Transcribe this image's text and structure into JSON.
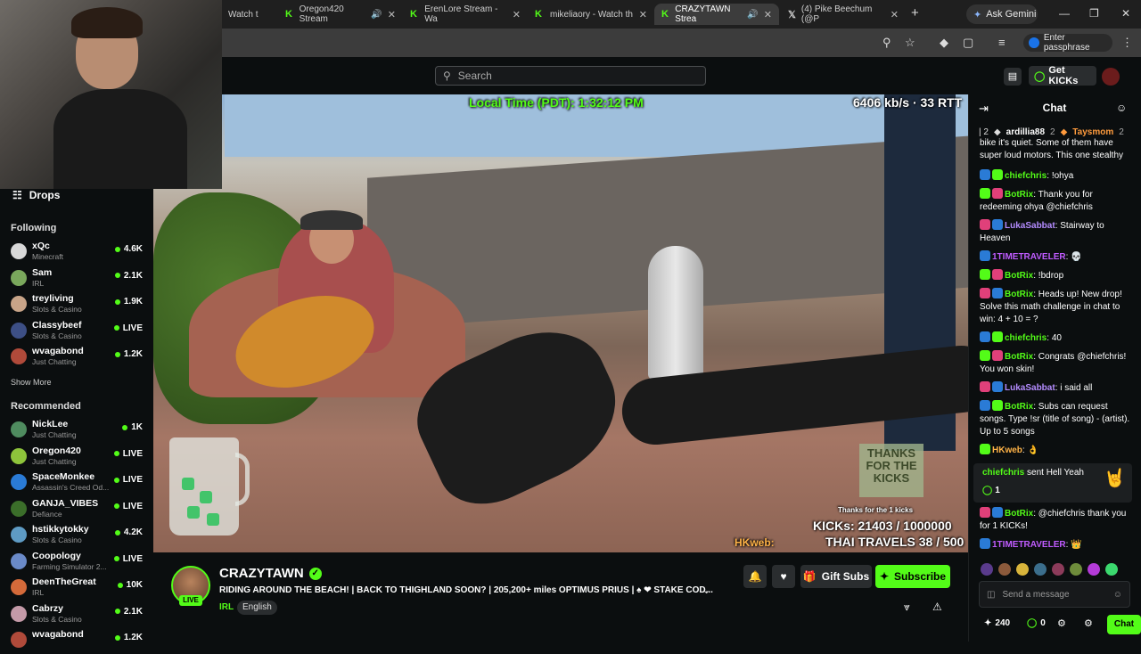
{
  "browser": {
    "tabs": [
      {
        "label": "Watch t",
        "partial": true
      },
      {
        "label": "Oregon420 Stream"
      },
      {
        "label": "ErenLore Stream - Wa"
      },
      {
        "label": "mikeliaory - Watch th"
      },
      {
        "label": "CRAZYTAWN Strea",
        "active": true
      },
      {
        "label": "(4) Pike Beechum (@P"
      }
    ],
    "ask_gemini": "Ask Gemini",
    "passphrase": "Enter passphrase"
  },
  "topnav": {
    "search_placeholder": "Search",
    "get_kicks": "Get KICKs"
  },
  "sidebar": {
    "drops": "Drops",
    "following_title": "Following",
    "following": [
      {
        "name": "xQc",
        "category": "Minecraft",
        "viewers": "4.6K",
        "color": "#d8d8d8"
      },
      {
        "name": "Sam",
        "category": "IRL",
        "viewers": "2.1K",
        "color": "#7aa85c"
      },
      {
        "name": "treyliving",
        "category": "Slots & Casino",
        "viewers": "1.9K",
        "color": "#c8a488"
      },
      {
        "name": "Classybeef",
        "category": "Slots & Casino",
        "viewers": "LIVE",
        "color": "#3d4f85"
      },
      {
        "name": "wvagabond",
        "category": "Just Chatting",
        "viewers": "1.2K",
        "color": "#b04a3a"
      }
    ],
    "show_more": "Show More",
    "recommended_title": "Recommended",
    "recommended": [
      {
        "name": "NickLee",
        "category": "Just Chatting",
        "viewers": "1K",
        "color": "#4f8c5f"
      },
      {
        "name": "Oregon420",
        "category": "Just Chatting",
        "viewers": "LIVE",
        "color": "#8ec43b"
      },
      {
        "name": "SpaceMonkee",
        "category": "Assassin's Creed Od...",
        "viewers": "LIVE",
        "color": "#2a7bd6"
      },
      {
        "name": "GANJA_VIBES",
        "category": "Defiance",
        "viewers": "LIVE",
        "color": "#3b6e2a"
      },
      {
        "name": "hstikkytokky",
        "category": "Slots & Casino",
        "viewers": "4.2K",
        "color": "#5e9bc4"
      },
      {
        "name": "Coopology",
        "category": "Farming Simulator 2...",
        "viewers": "LIVE",
        "color": "#6a8ac8"
      },
      {
        "name": "DeenTheGreat",
        "category": "IRL",
        "viewers": "10K",
        "color": "#d46a3a"
      },
      {
        "name": "Cabrzy",
        "category": "Slots & Casino",
        "viewers": "2.1K",
        "color": "#c49aa8"
      },
      {
        "name": "wvagabond",
        "category": "",
        "viewers": "1.2K",
        "color": "#b04a3a"
      }
    ]
  },
  "video": {
    "local_time": "Local Time (PDT): 1:32:12 PM",
    "stats": "6406 kb/s · 33 RTT",
    "kicks": "KICKs: 21403 / 1000000",
    "travels": "THAI TRAVELS 38 / 500",
    "hkweb": "HKweb:",
    "thanks_box": "THANKS FOR THE KICKS",
    "thanks_line": "Thanks for the 1 kicks"
  },
  "channel": {
    "name": "CRAZYTAWN",
    "live": "LIVE",
    "title": "RIDING AROUND THE BEACH! | BACK TO THIGHLAND SOON? | 205,200+ miles OPTIMUS PRIUS | ♠ ❤ STAKE COD...",
    "category": "IRL",
    "language": "English",
    "gift_subs": "Gift Subs",
    "subscribe": "Subscribe"
  },
  "chat": {
    "title": "Chat",
    "top_gifters": [
      {
        "name": "ardillia88",
        "count": "2"
      },
      {
        "name": "Taysmom",
        "count": "2"
      }
    ],
    "messages": [
      {
        "user": "",
        "text": "bike it's quiet. Some of them have super loud motors. This one stealthy",
        "color": "#fff"
      },
      {
        "user": "chiefchris",
        "text": "!ohya",
        "color": "#53fc18"
      },
      {
        "user": "BotRix",
        "text": "Thank you for redeeming ohya @chiefchris",
        "color": "#53fc18"
      },
      {
        "user": "LukaSabbat",
        "text": "Stairway to Heaven",
        "color": "#b48cff"
      },
      {
        "user": "1TIMETRAVELER",
        "text": "💀",
        "color": "#c05cff"
      },
      {
        "user": "BotRix",
        "text": "!bdrop",
        "color": "#53fc18"
      },
      {
        "user": "BotRix",
        "text": "Heads up! New drop! Solve this math challenge in chat to win: 4 + 10 = ?",
        "color": "#53fc18"
      },
      {
        "user": "chiefchris",
        "text": "40",
        "color": "#53fc18"
      },
      {
        "user": "BotRix",
        "text": "Congrats @chiefchris! You won skin!",
        "color": "#53fc18"
      },
      {
        "user": "LukaSabbat",
        "text": "i said all",
        "color": "#b48cff"
      },
      {
        "user": "BotRix",
        "text": "Subs can request songs. Type !sr (title of song) - (artist). Up to 5 songs",
        "color": "#53fc18"
      },
      {
        "user": "HKweb",
        "text": "👌",
        "color": "#ffb347"
      },
      {
        "user": "BotRix",
        "text": "@chiefchris thank you for 1 KICKs!",
        "color": "#53fc18"
      },
      {
        "user": "1TIMETRAVELER",
        "text": "👑",
        "color": "#c05cff"
      }
    ],
    "kick_gift": {
      "user": "chiefchris",
      "text": "sent Hell Yeah",
      "count": "1"
    },
    "input_placeholder": "Send a message",
    "points": "240",
    "kicks_count": "0",
    "chat_button": "Chat"
  }
}
